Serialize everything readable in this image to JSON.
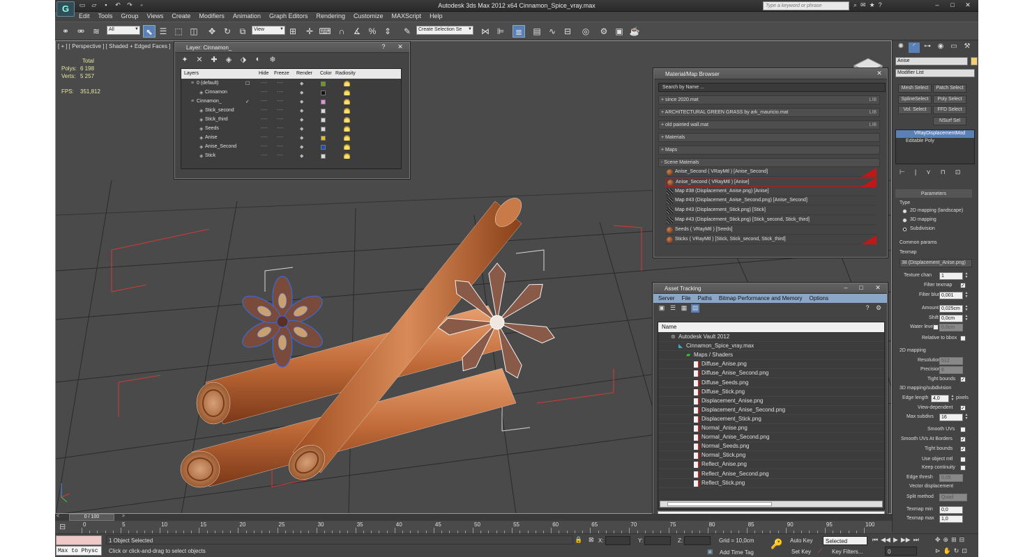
{
  "app": {
    "title": "Autodesk 3ds Max  2012 x64     Cinnamon_Spice_vray.max",
    "icon_label": "G",
    "search_placeholder": "Type a keyword or phrase"
  },
  "menu": [
    "Edit",
    "Tools",
    "Group",
    "Views",
    "Create",
    "Modifiers",
    "Animation",
    "Graph Editors",
    "Rendering",
    "Customize",
    "MAXScript",
    "Help"
  ],
  "toolbar": {
    "selection_filter": "All",
    "ref_coord": "View",
    "named_selection": "Create Selection Se"
  },
  "viewport": {
    "label": "[ + ] [ Perspective ] [ Shaded + Edged Faces ]",
    "stats": {
      "total_label": "Total",
      "polys_label": "Polys:",
      "polys_value": "6 198",
      "verts_label": "Verts:",
      "verts_value": "5 257",
      "fps_label": "FPS:",
      "fps_value": "351,812"
    }
  },
  "layer_manager": {
    "title": "Layer: Cinnamon_",
    "help_btn": "?",
    "close_btn": "✕",
    "columns": [
      "Layers",
      "Hide",
      "Freeze",
      "Render",
      "Color",
      "Radiosity"
    ],
    "rows": [
      {
        "name": "0 (default)",
        "indent": 0,
        "color": "#6a9a1a",
        "current": "☐"
      },
      {
        "name": "Cinnamon",
        "indent": 1,
        "color": "#111111",
        "current": ""
      },
      {
        "name": "Cinnamon_",
        "indent": 0,
        "color": "#e890e0",
        "current": "✓"
      },
      {
        "name": "Stick_second",
        "indent": 1,
        "color": "#d8d8d8",
        "current": ""
      },
      {
        "name": "Stick_third",
        "indent": 1,
        "color": "#d8d8d8",
        "current": ""
      },
      {
        "name": "Seeds",
        "indent": 1,
        "color": "#d8d8d8",
        "current": ""
      },
      {
        "name": "Anise",
        "indent": 1,
        "color": "#e0c020",
        "current": ""
      },
      {
        "name": "Anise_Second",
        "indent": 1,
        "color": "#1a50c0",
        "current": ""
      },
      {
        "name": "Stick",
        "indent": 1,
        "color": "#d8d8d8",
        "current": ""
      }
    ],
    "dash": "----"
  },
  "material_browser": {
    "title": "Material/Map Browser",
    "close_btn": "✕",
    "search_placeholder": "Search by Name ...",
    "libraries": [
      {
        "label": "+ since 2020.mat",
        "tag": "LIB"
      },
      {
        "label": "+ ARCHITECTURAL GREEN GRASS by ark_mauricio.mat",
        "tag": "LIB"
      },
      {
        "label": "+ old painted wall.mat",
        "tag": "LIB"
      },
      {
        "label": "+ Materials",
        "tag": ""
      },
      {
        "label": "+ Maps",
        "tag": ""
      },
      {
        "label": "- Scene Materials",
        "tag": ""
      }
    ],
    "scene_materials": [
      {
        "label": "Anise_Second  ( VRayMtl )  [Anise_Second]",
        "kind": "mtl",
        "flag": true,
        "selected": false
      },
      {
        "label": "Anise_Second  ( VRayMtl )  [Anise]",
        "kind": "mtl",
        "flag": true,
        "selected": true
      },
      {
        "label": "Map #38 (Displacement_Anise.png)  [Anise]",
        "kind": "map",
        "flag": false,
        "selected": false
      },
      {
        "label": "Map #43 (Displacement_Anise_Second.png)  [Anise_Second]",
        "kind": "map",
        "flag": false,
        "selected": false
      },
      {
        "label": "Map #43 (Displacement_Stick.png)  [Stick]",
        "kind": "map",
        "flag": false,
        "selected": false
      },
      {
        "label": "Map #43 (Displacement_Stick.png)  [Stick_second, Stick_third]",
        "kind": "map",
        "flag": false,
        "selected": false
      },
      {
        "label": "Seeds  ( VRayMtl )  [Seeds]",
        "kind": "mtl",
        "flag": false,
        "selected": false
      },
      {
        "label": "Sticks  ( VRayMtl )  [Stick, Stick_second, Stick_third]",
        "kind": "mtl",
        "flag": true,
        "selected": false
      }
    ]
  },
  "asset_tracking": {
    "title": "Asset Tracking",
    "menu": [
      "Server",
      "File",
      "Paths",
      "Bitmap Performance and Memory",
      "Options"
    ],
    "column": "Name",
    "tree": [
      {
        "label": "Autodesk Vault 2012",
        "indent": 0,
        "type": "vault"
      },
      {
        "label": "Cinnamon_Spice_vray.max",
        "indent": 1,
        "type": "max"
      },
      {
        "label": "Maps / Shaders",
        "indent": 2,
        "type": "folder"
      },
      {
        "label": "Diffuse_Anise.png",
        "indent": 3,
        "type": "file"
      },
      {
        "label": "Diffuse_Anise_Second.png",
        "indent": 3,
        "type": "file"
      },
      {
        "label": "Diffuse_Seeds.png",
        "indent": 3,
        "type": "file"
      },
      {
        "label": "Diffuse_Stick.png",
        "indent": 3,
        "type": "file"
      },
      {
        "label": "Displacement_Anise.png",
        "indent": 3,
        "type": "file"
      },
      {
        "label": "Displacement_Anise_Second.png",
        "indent": 3,
        "type": "file"
      },
      {
        "label": "Displacement_Stick.png",
        "indent": 3,
        "type": "file"
      },
      {
        "label": "Normal_Anise.png",
        "indent": 3,
        "type": "file"
      },
      {
        "label": "Normal_Anise_Second.png",
        "indent": 3,
        "type": "file"
      },
      {
        "label": "Normal_Seeds.png",
        "indent": 3,
        "type": "file"
      },
      {
        "label": "Normal_Stick.png",
        "indent": 3,
        "type": "file"
      },
      {
        "label": "Reflect_Anise.png",
        "indent": 3,
        "type": "file"
      },
      {
        "label": "Reflect_Anise_Second.png",
        "indent": 3,
        "type": "file"
      },
      {
        "label": "Reflect_Stick.png",
        "indent": 3,
        "type": "file"
      }
    ]
  },
  "command_panel": {
    "object_name": "Anise",
    "modifier_list": "Modifier List",
    "buttons": [
      "Mesh Select",
      "Patch Select",
      "SplineSelect",
      "Poly Select",
      "Vol. Select",
      "FFD Select",
      "NSurf Sel"
    ],
    "stack": [
      "VRayDisplacementMod",
      "Editable Poly"
    ],
    "params_title": "Parameters",
    "type_label": "Type",
    "type_options": [
      "2D mapping (landscape)",
      "3D mapping",
      "Subdivision"
    ],
    "common_params": "Common params",
    "texmap_label": "Texmap",
    "texmap_value": "38 (Displacement_Anise.png)",
    "texture_chan_label": "Texture chan",
    "texture_chan_value": "1",
    "filter_texmap": "Filter texmap",
    "filter_blur_label": "Filter blur",
    "filter_blur_value": "0,001",
    "amount_label": "Amount",
    "amount_value": "0,025cm",
    "shift_label": "Shift",
    "shift_value": "0,0cm",
    "water_level_label": "Water level",
    "water_level_value": "0,0cm",
    "relative_bbox": "Relative to bbox",
    "mapping2d": "2D mapping",
    "resolution_label": "Resolution",
    "resolution_value": "512",
    "precision_label": "Precision",
    "precision_value": "8",
    "tight_bounds": "Tight bounds",
    "mapping3d": "3D mapping/subdivision",
    "edge_length_label": "Edge length",
    "edge_length_value": "4,0",
    "pixels_label": "pixels",
    "view_dependent": "View-dependent",
    "max_subdivs_label": "Max subdivs",
    "max_subdivs_value": "16",
    "smooth_uvs": "Smooth UVs",
    "smooth_uvs_borders": "Smooth UVs At Borders",
    "tight_bounds2": "Tight bounds",
    "use_object_mtl": "Use object mtl",
    "keep_continuity": "Keep continuity",
    "edge_thresh_label": "Edge thresh",
    "edge_thresh_value": "0,05",
    "vector_displacement": "Vector displacement",
    "split_method_label": "Split method",
    "split_method_value": "Quad",
    "texmap_min_label": "Texmap min",
    "texmap_min_value": "0,0",
    "texmap_max_label": "Texmap max",
    "texmap_max_value": "1,0"
  },
  "timeline": {
    "frame_label": "0 / 100",
    "ticks": [
      "0",
      "5",
      "10",
      "15",
      "20",
      "25",
      "30",
      "35",
      "40",
      "45",
      "50",
      "55",
      "60",
      "65",
      "70",
      "75",
      "80",
      "85",
      "90",
      "95",
      "100"
    ]
  },
  "status": {
    "script_label": "Max to Physc",
    "selected": "1 Object Selected",
    "prompt": "Click or click-and-drag to select objects",
    "x_label": "X:",
    "y_label": "Y:",
    "z_label": "Z:",
    "grid": "Grid = 10,0cm",
    "add_time_tag": "Add Time Tag",
    "auto_key": "Auto Key",
    "set_key": "Set Key",
    "selected_combo": "Selected",
    "key_filters": "Key Filters...",
    "frame_value": "0"
  }
}
